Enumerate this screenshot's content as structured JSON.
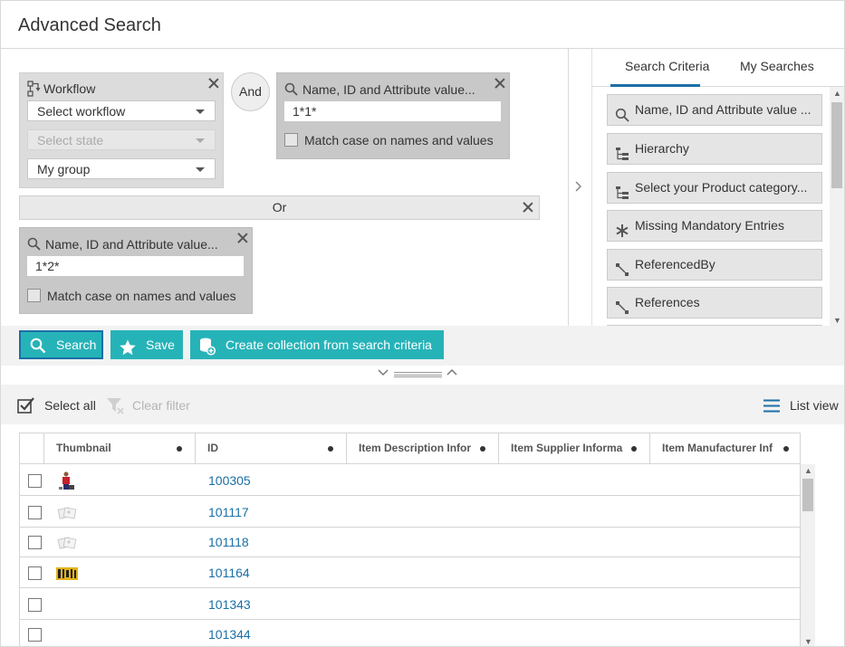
{
  "header": {
    "title": "Advanced Search"
  },
  "criteria": {
    "workflow_box": {
      "label": "Workflow",
      "workflow_select": "Select workflow",
      "state_select": "Select state",
      "group_select": "My group"
    },
    "and_label": "And",
    "search_box_1": {
      "label": "Name, ID and Attribute value...",
      "value": "1*1*",
      "match_case_label": "Match case on names and values"
    },
    "or_label": "Or",
    "search_box_2": {
      "label": "Name, ID and Attribute value...",
      "value": "1*2*",
      "match_case_label": "Match case on names and values"
    }
  },
  "right_panel": {
    "tabs": [
      {
        "label": "Search Criteria",
        "active": true
      },
      {
        "label": "My Searches",
        "active": false
      }
    ],
    "items": [
      {
        "label": "Name, ID and Attribute value ...",
        "icon": "search-icon"
      },
      {
        "label": "Hierarchy",
        "icon": "hierarchy-icon"
      },
      {
        "label": "Select your Product category...",
        "icon": "hierarchy-icon"
      },
      {
        "label": "Missing Mandatory Entries",
        "icon": "asterisk-icon"
      },
      {
        "label": "ReferencedBy",
        "icon": "reference-icon"
      },
      {
        "label": "References",
        "icon": "reference-icon"
      }
    ]
  },
  "actions": {
    "search_label": "Search",
    "save_label": "Save",
    "create_collection_label": "Create collection from search criteria"
  },
  "toolbar": {
    "select_all_label": "Select all",
    "clear_filter_label": "Clear filter",
    "list_view_label": "List view"
  },
  "grid": {
    "columns": [
      "Thumbnail",
      "ID",
      "Item Description Infor",
      "Item Supplier Informa",
      "Item Manufacturer Inf"
    ],
    "rows": [
      {
        "id": "100305",
        "thumbnail": "person"
      },
      {
        "id": "101117",
        "thumbnail": "placeholder"
      },
      {
        "id": "101118",
        "thumbnail": "placeholder"
      },
      {
        "id": "101164",
        "thumbnail": "tools"
      },
      {
        "id": "101343",
        "thumbnail": "none"
      },
      {
        "id": "101344",
        "thumbnail": "none"
      }
    ]
  },
  "colors": {
    "accent": "#26b3b8",
    "link": "#1a6fa6"
  }
}
